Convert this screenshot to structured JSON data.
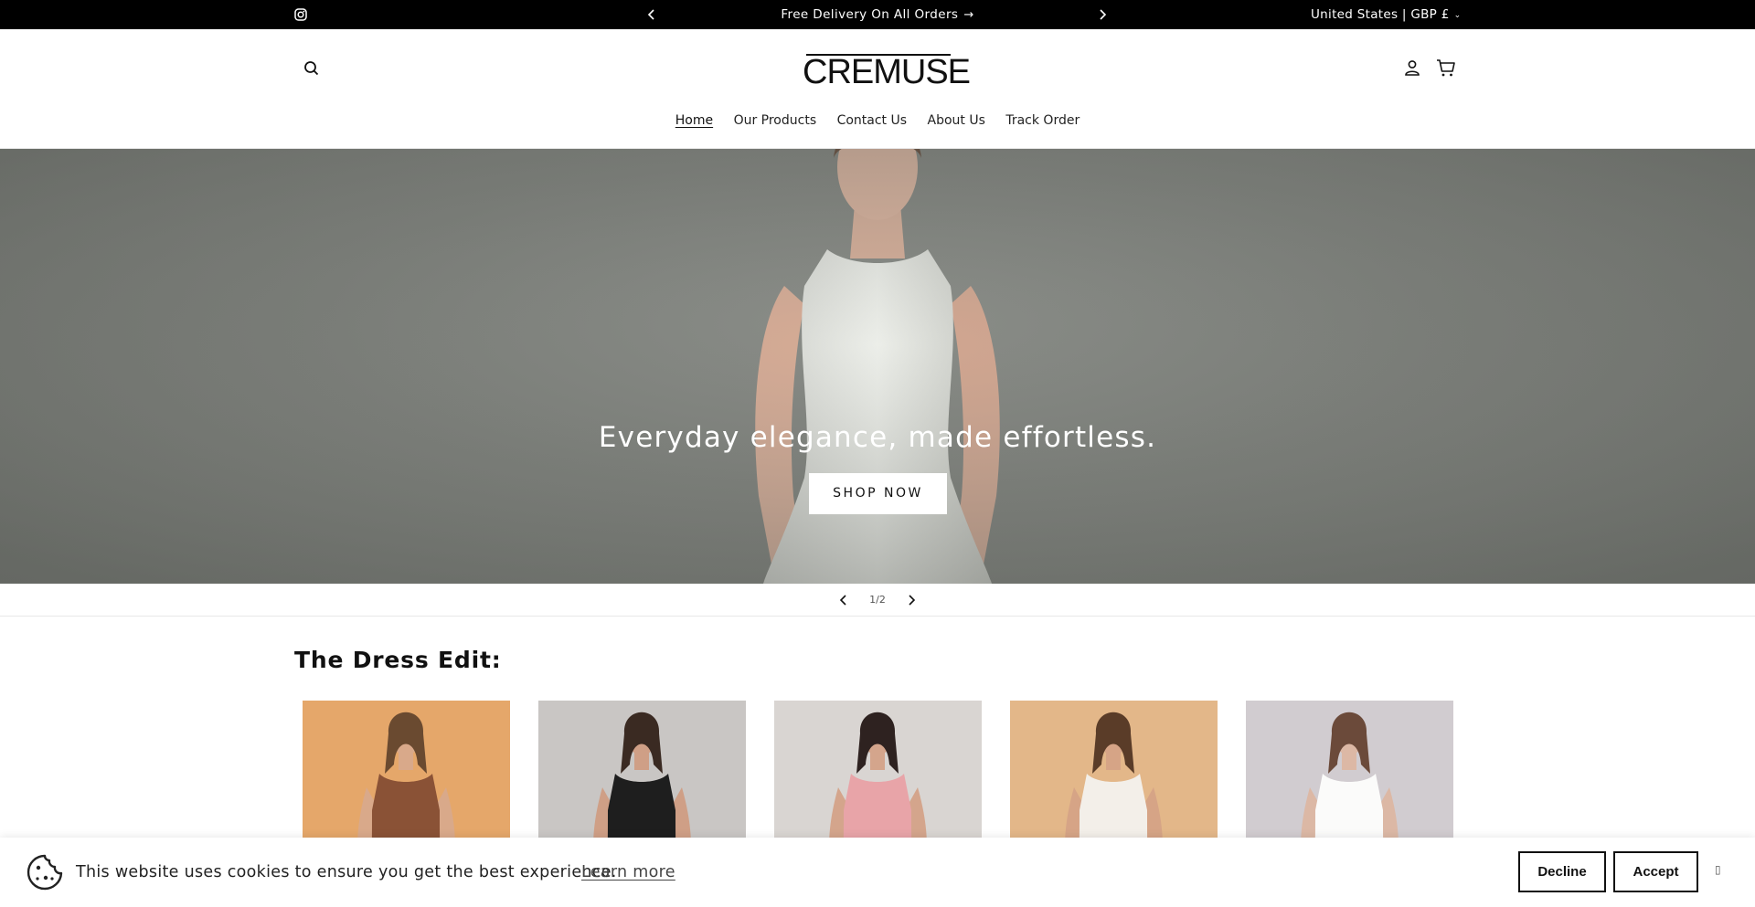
{
  "announcement": {
    "message": "Free Delivery On All Orders",
    "locale": "United States | GBP £"
  },
  "header": {
    "logo": "CREMUSE",
    "nav": [
      "Home",
      "Our Products",
      "Contact Us",
      "About Us",
      "Track Order"
    ],
    "active_nav": "Home"
  },
  "hero": {
    "title": "Everyday elegance, made effortless.",
    "cta": "SHOP NOW"
  },
  "slider": {
    "counter": "1/2"
  },
  "collection": {
    "title": "The Dress Edit:",
    "products": [
      {
        "bg": "#e5a76a",
        "dress": "#8a5236",
        "skin": "#d9a98a",
        "hair": "#6a4a30"
      },
      {
        "bg": "#c9c6c4",
        "dress": "#1e1e1e",
        "skin": "#cf9f86",
        "hair": "#3a2a22"
      },
      {
        "bg": "#d9d5d2",
        "dress": "#e8a4a8",
        "skin": "#d4a58c",
        "hair": "#2e2220"
      },
      {
        "bg": "#e3b789",
        "dress": "#f3efe9",
        "skin": "#d6a486",
        "hair": "#5a3c28"
      },
      {
        "bg": "#d1ccd0",
        "dress": "#fbfbfa",
        "skin": "#dcb8a5",
        "hair": "#6b4a3a"
      }
    ]
  },
  "cookie": {
    "text": "This website uses cookies to ensure you get the best experience.",
    "learn_more": "Learn more",
    "decline": "Decline",
    "accept": "Accept"
  }
}
